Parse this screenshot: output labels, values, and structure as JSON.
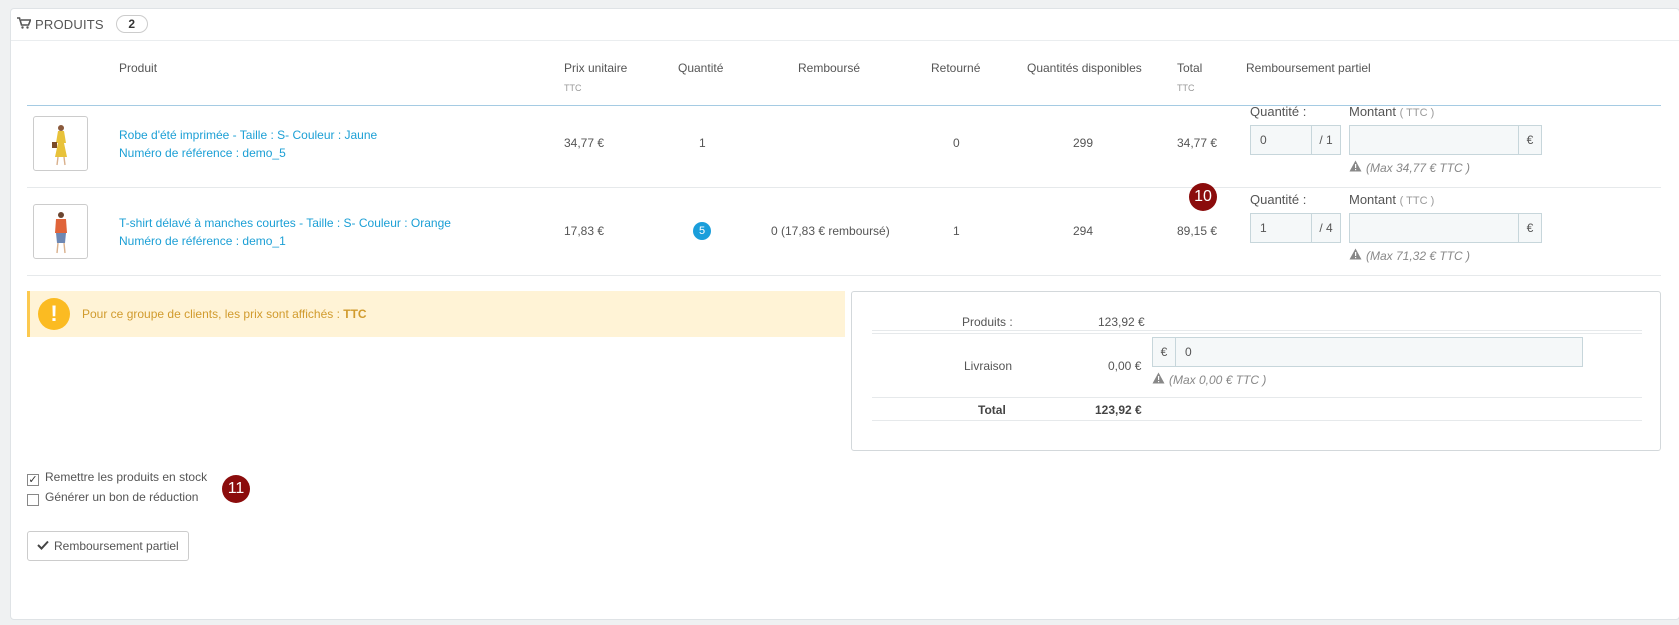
{
  "panel": {
    "title": "PRODUITS",
    "count": "2"
  },
  "table": {
    "headers": {
      "product": "Produit",
      "unit_price": "Prix unitaire",
      "unit_price_sub": "TTC",
      "quantity": "Quantité",
      "refunded": "Remboursé",
      "returned": "Retourné",
      "available": "Quantités disponibles",
      "total": "Total",
      "total_sub": "TTC",
      "partial_refund": "Remboursement partiel"
    },
    "rows": [
      {
        "name": "Robe d'été imprimée - Taille : S- Couleur : Jaune",
        "reference": "Numéro de référence : demo_5",
        "unit_price": "34,77 €",
        "quantity": "1",
        "refunded": "",
        "returned": "0",
        "available": "299",
        "total": "34,77 €",
        "qty_label": "Quantité :",
        "amount_label": "Montant",
        "amount_sub": "( TTC )",
        "qty_value": "0",
        "qty_max": "/ 1",
        "amount_value": "",
        "currency": "€",
        "help": "(Max 34,77 € TTC )"
      },
      {
        "name": "T-shirt délavé à manches courtes - Taille : S- Couleur : Orange",
        "reference": "Numéro de référence : demo_1",
        "unit_price": "17,83 €",
        "quantity": "5",
        "refunded": "0 (17,83 € remboursé)",
        "returned": "1",
        "available": "294",
        "total": "89,15 €",
        "qty_label": "Quantité :",
        "amount_label": "Montant",
        "amount_sub": "( TTC )",
        "qty_value": "1",
        "qty_max": "/ 4",
        "amount_value": "",
        "currency": "€",
        "help": "(Max 71,32 € TTC )"
      }
    ]
  },
  "callouts": {
    "first": "10",
    "second": "11"
  },
  "alert": {
    "text": "Pour ce groupe de clients, les prix sont affichés : ",
    "strong": "TTC"
  },
  "summary": {
    "products_label": "Produits :",
    "products_value": "123,92 €",
    "shipping_label": "Livraison",
    "shipping_value": "0,00 €",
    "shipping_currency": "€",
    "shipping_input": "0",
    "shipping_help": "(Max 0,00 € TTC )",
    "total_label": "Total",
    "total_value": "123,92 €"
  },
  "options": {
    "restock_label": "Remettre les produits en stock",
    "restock_checked": true,
    "voucher_label": "Générer un bon de réduction",
    "voucher_checked": false
  },
  "submit_label": "Remboursement partiel",
  "colors": {
    "link": "#1b9fd5",
    "badge": "#1a9edb",
    "callout": "#8b0c0c",
    "alert_bg": "#fff3d6",
    "alert_icon": "#fbbb22"
  },
  "icons": {
    "cart": "cart-icon",
    "check": "check-icon",
    "warning": "warning-icon",
    "exclamation": "exclamation-icon"
  }
}
